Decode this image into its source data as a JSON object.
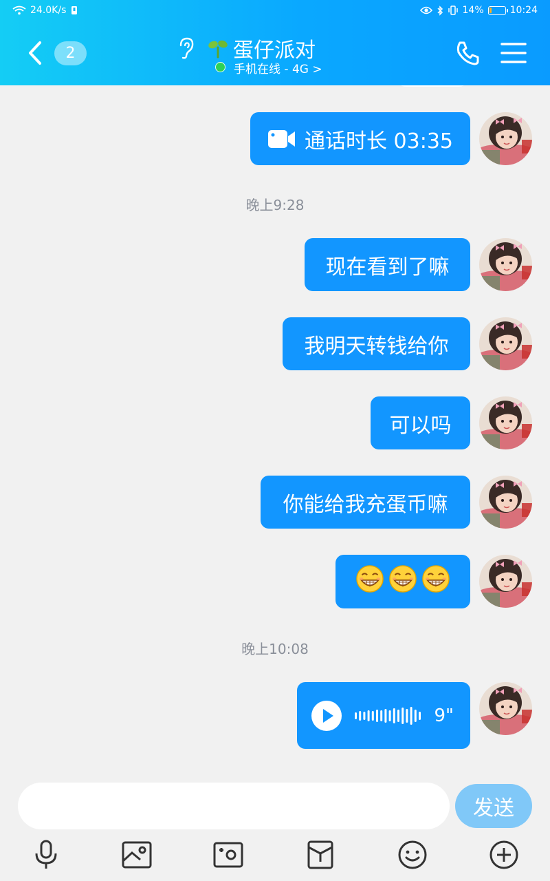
{
  "status_bar": {
    "net_speed": "24.0K/s",
    "battery_percent": "14%",
    "battery_level": 0.14,
    "time": "10:24"
  },
  "header": {
    "unread_count": "2",
    "title": "蛋仔派对",
    "online_status": "手机在线 - 4G >",
    "accent_color": "#0aa8ff",
    "online_color": "#2ed157"
  },
  "messages": [
    {
      "type": "video_call",
      "icon": "video-camera-icon",
      "text": "通话时长 03:35"
    },
    {
      "type": "timestamp",
      "text": "晚上9:28"
    },
    {
      "type": "text",
      "text": "现在看到了嘛"
    },
    {
      "type": "text",
      "text": "我明天转钱给你"
    },
    {
      "type": "text",
      "text": "可以吗"
    },
    {
      "type": "text",
      "text": "你能给我充蛋币嘛"
    },
    {
      "type": "emoji",
      "emoji": [
        "grinning-face",
        "grinning-face",
        "grinning-face"
      ]
    },
    {
      "type": "timestamp",
      "text": "晚上10:08"
    },
    {
      "type": "voice",
      "duration": "9\""
    }
  ],
  "bubble_color": "#1296ff",
  "input_bar": {
    "placeholder": "",
    "send_label": "发送",
    "send_color": "#80c8f8"
  },
  "toolbar_icons": [
    "microphone-icon",
    "picture-icon",
    "camera-icon",
    "red-packet-icon",
    "smiley-icon",
    "plus-icon"
  ]
}
